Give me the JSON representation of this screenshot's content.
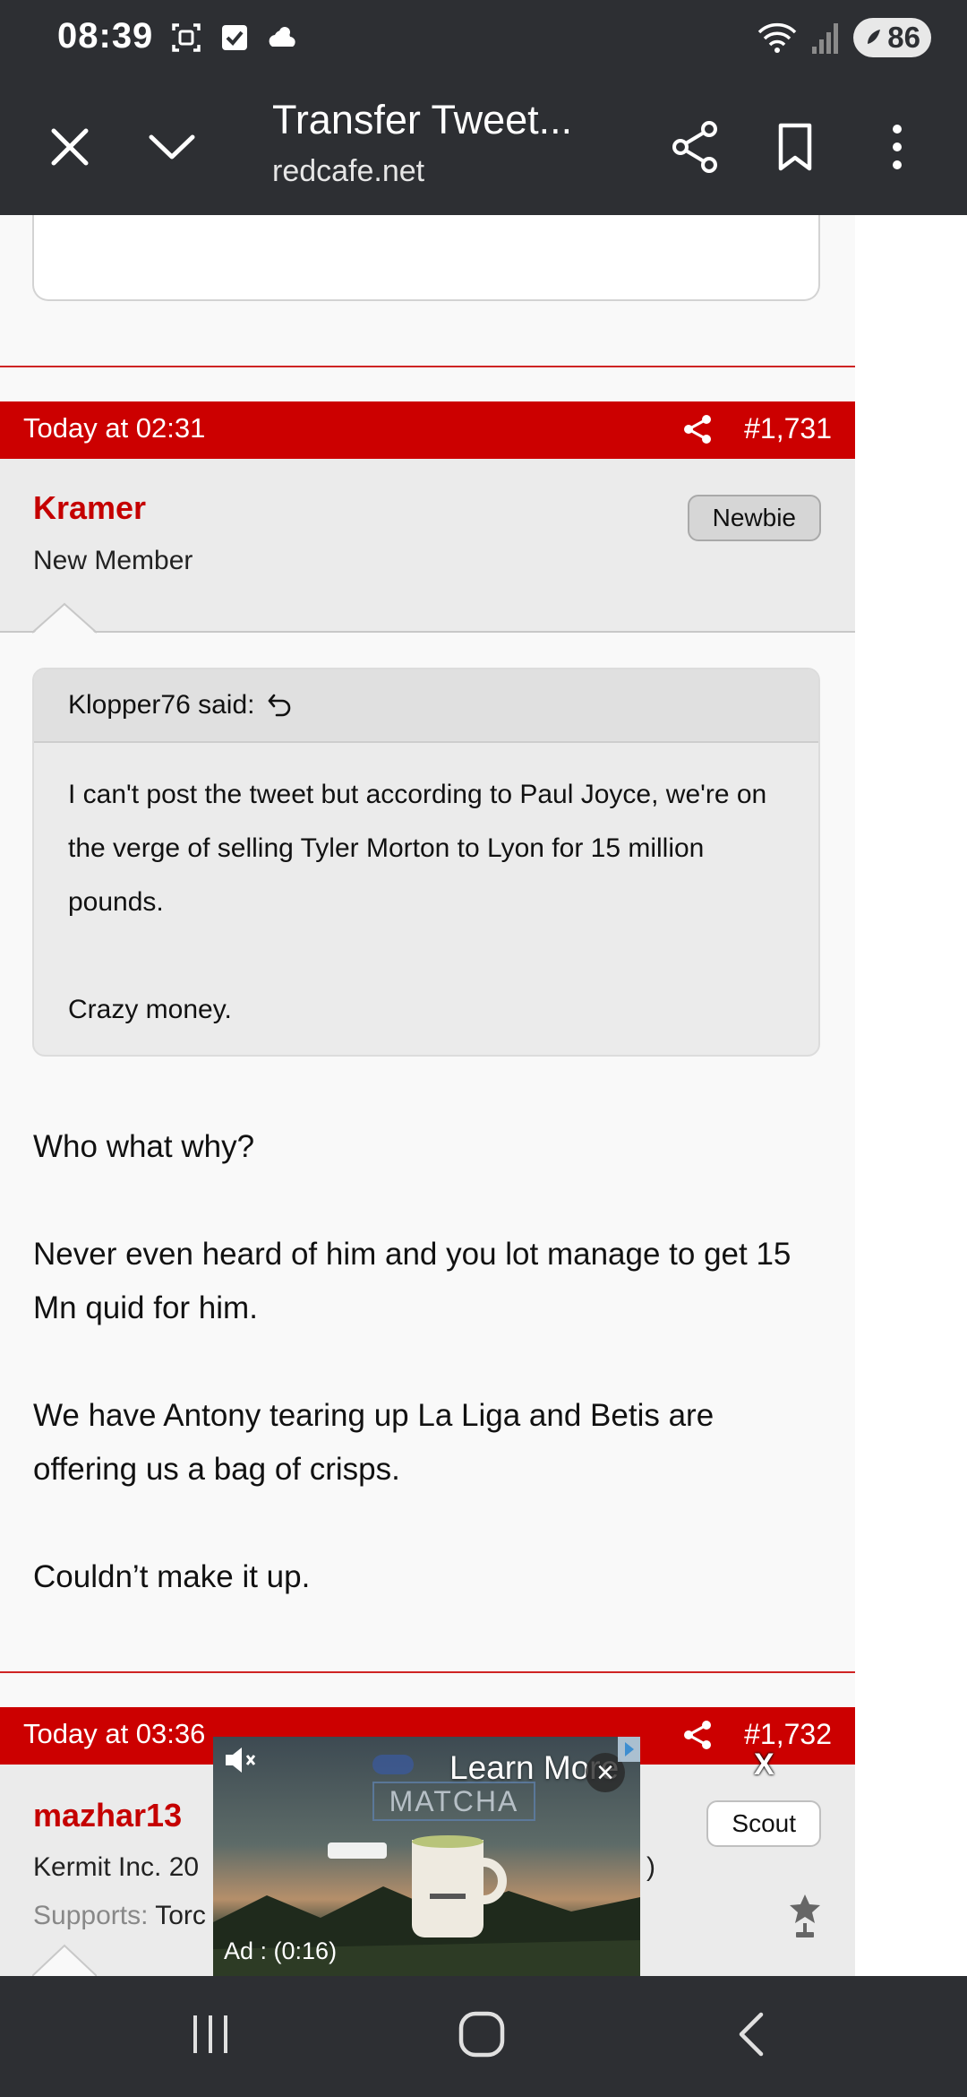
{
  "status_bar": {
    "time": "08:39",
    "battery": "86",
    "icons": [
      "screenshot-icon",
      "check-icon",
      "weather-icon",
      "wifi-icon",
      "signal-icon",
      "battery-icon"
    ]
  },
  "toolbar": {
    "title": "Transfer Tweet...",
    "url": "redcafe.net",
    "icons": [
      "close-icon",
      "chevron-down-icon",
      "share-icon",
      "bookmark-icon",
      "more-icon"
    ]
  },
  "posts": [
    {
      "date": "Today at 02:31",
      "number": "#1,731",
      "username": "Kramer",
      "user_title": "New Member",
      "badge": "Newbie",
      "quote": {
        "author": "Klopper76 said:",
        "body": [
          "I can't post the tweet but according to Paul Joyce, we're on the verge of selling Tyler Morton to Lyon for 15 million pounds.",
          "Crazy money."
        ]
      },
      "body": [
        "Who what why?",
        "Never even heard of him and you lot manage to get 15 Mn quid for him.",
        "We have Antony tearing up La Liga and Betis are offering us a bag of crisps.",
        "Couldn’t make it up."
      ]
    },
    {
      "date": "Today at 03:36",
      "number": "#1,732",
      "username": "mazhar13",
      "user_title": "Kermit Inc. 20",
      "user_title_tail": ")",
      "supports_label": "Supports:",
      "supports_value": "Torc",
      "badge": "Scout"
    }
  ],
  "ad": {
    "learn_more": "Learn More",
    "close": "×",
    "timer": "Ad : (0:16)",
    "brand_text": "MATCHA",
    "outside_close": "X"
  },
  "colors": {
    "accent_red": "#cc0000",
    "username_red": "#c50000",
    "chrome_dark": "#2d2f33"
  }
}
